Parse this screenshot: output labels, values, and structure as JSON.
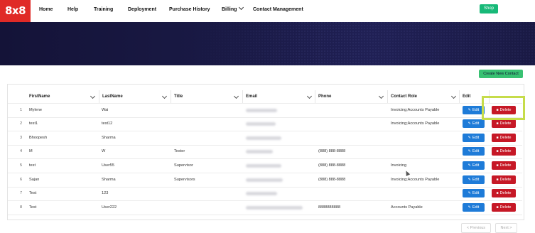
{
  "nav": {
    "logo": "8x8",
    "items": [
      "Home",
      "Help",
      "Training",
      "Deployment",
      "Purchase History",
      "Billing",
      "Contact Management"
    ],
    "shop": "Shop"
  },
  "toolbar": {
    "create": "Create New Contact"
  },
  "table": {
    "headers": [
      "FirstName",
      "LastName",
      "Title",
      "Email",
      "Phone",
      "Contact Role",
      "Edit"
    ],
    "edit_label": "Edit",
    "delete_label": "Delete",
    "rows": [
      {
        "n": "1",
        "first": "Mylene",
        "last": "Wai",
        "title": "",
        "phone": "",
        "role": "Invoicing;Accounts Payable"
      },
      {
        "n": "2",
        "first": "test1",
        "last": "test12",
        "title": "",
        "phone": "",
        "role": "Invoicing;Accounts Payable"
      },
      {
        "n": "3",
        "first": "Bhoopesh",
        "last": "Sharma",
        "title": "",
        "phone": "",
        "role": ""
      },
      {
        "n": "4",
        "first": "M",
        "last": "W",
        "title": "Tester",
        "phone": "(888) 888-8888",
        "role": ""
      },
      {
        "n": "5",
        "first": "test",
        "last": "User55",
        "title": "Supervisor",
        "phone": "(888) 888-8888",
        "role": "Invoicing"
      },
      {
        "n": "6",
        "first": "Sajan",
        "last": "Sharma",
        "title": "Supervisors",
        "phone": "(888) 888-8888",
        "role": "Invoicing;Accounts Payable"
      },
      {
        "n": "7",
        "first": "Test",
        "last": "123",
        "title": "",
        "phone": "",
        "role": ""
      },
      {
        "n": "8",
        "first": "Test",
        "last": "User222",
        "title": "",
        "phone": "8888888888",
        "role": "Accounts Payable"
      }
    ]
  },
  "pager": {
    "previous": "< Previous",
    "next": "Next >"
  },
  "colors": {
    "brand": "#e02a27",
    "edit": "#1e7bd8",
    "delete": "#c61826",
    "create": "#38c172",
    "shop": "#17b978",
    "highlight": "#c6dc4a"
  },
  "icons": {
    "edit": "pencil-icon",
    "delete": "trash-icon",
    "dropdown": "chevron-down-icon"
  }
}
